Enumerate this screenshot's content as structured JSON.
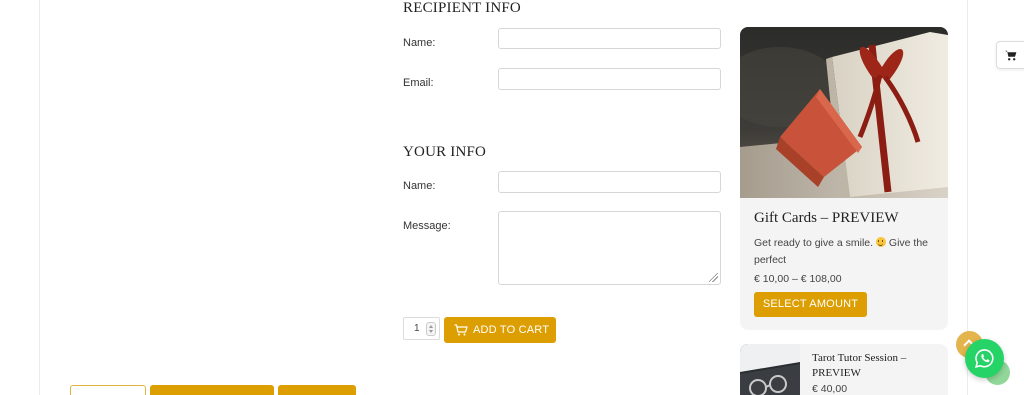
{
  "recipient": {
    "heading": "RECIPIENT INFO",
    "name_label": "Name:",
    "name_value": "",
    "email_label": "Email:",
    "email_value": ""
  },
  "your_info": {
    "heading": "YOUR INFO",
    "name_label": "Name:",
    "name_value": "",
    "message_label": "Message:",
    "message_value": ""
  },
  "cart": {
    "quantity": "1",
    "add_to_cart_label": "ADD TO CART"
  },
  "products": [
    {
      "title": "Gift Cards – PREVIEW",
      "description": "Get ready to give a smile.",
      "description_tail": " Give the perfect",
      "price": "€ 10,00 – € 108,00",
      "button_label": "SELECT AMOUNT"
    },
    {
      "title": "Tarot Tutor Session – PREVIEW",
      "price": "€ 40,00"
    }
  ],
  "icons": {
    "floating_cart": "shopping-cart-icon",
    "scroll_top": "chevron-up-icon",
    "whatsapp": "whatsapp-icon",
    "emoji": "smiley-emoji-icon"
  },
  "colors": {
    "accent": "#dc9e00",
    "whatsapp": "#25d366",
    "card_bg": "#f4f4f4"
  }
}
